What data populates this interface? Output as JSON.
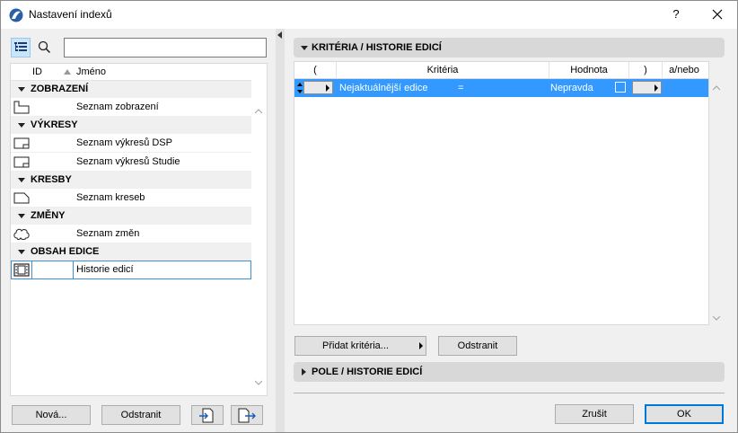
{
  "window": {
    "title": "Nastavení indexů",
    "help": "?"
  },
  "left": {
    "search": {
      "value": "",
      "placeholder": ""
    },
    "columns": {
      "id": "ID",
      "name": "Jméno"
    },
    "groups": [
      {
        "label": "ZOBRAZENÍ",
        "items": [
          {
            "name": "Seznam zobrazení",
            "icon": "view-map-icon"
          }
        ]
      },
      {
        "label": "VÝKRESY",
        "items": [
          {
            "name": "Seznam výkresů DSP",
            "icon": "layout-icon"
          },
          {
            "name": "Seznam výkresů Studie",
            "icon": "layout-icon"
          }
        ]
      },
      {
        "label": "KRESBY",
        "items": [
          {
            "name": "Seznam kreseb",
            "icon": "drawing-icon"
          }
        ]
      },
      {
        "label": "ZMĚNY",
        "items": [
          {
            "name": "Seznam změn",
            "icon": "cloud-icon"
          }
        ]
      },
      {
        "label": "OBSAH EDICE",
        "items": [
          {
            "name": "Historie edicí",
            "icon": "film-icon",
            "selected": true
          }
        ]
      }
    ],
    "buttons": {
      "new": "Nová...",
      "delete": "Odstranit"
    }
  },
  "right": {
    "criteria_section": "KRITÉRIA /  HISTORIE EDICÍ",
    "columns": {
      "open_paren": "(",
      "criteria": "Kritéria",
      "value": "Hodnota",
      "close_paren": ")",
      "and_or": "a/nebo"
    },
    "rows": [
      {
        "criterion": "Nejaktuálnější edice",
        "operator": "=",
        "value": "Nepravda",
        "checked": false
      }
    ],
    "buttons": {
      "add_criteria": "Přidat kritéria...",
      "delete": "Odstranit"
    },
    "fields_section": "POLE /  HISTORIE EDICÍ"
  },
  "footer": {
    "cancel": "Zrušit",
    "ok": "OK"
  },
  "colors": {
    "selection": "#3399ff",
    "accent": "#0078d7"
  }
}
